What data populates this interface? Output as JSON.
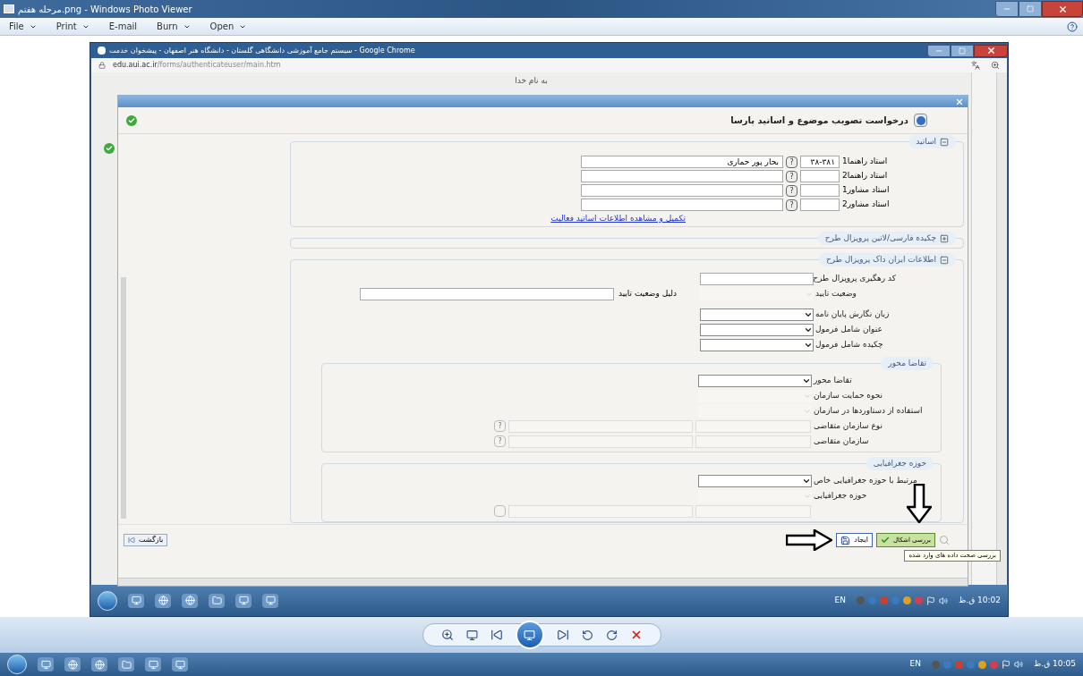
{
  "viewer": {
    "title": "مرحله هفتم.png - Windows Photo Viewer",
    "menu": {
      "file": {
        "label": "File",
        "dropdown": true
      },
      "print": {
        "label": "Print",
        "dropdown": true
      },
      "email": {
        "label": "E-mail",
        "dropdown": false
      },
      "burn": {
        "label": "Burn",
        "dropdown": true
      },
      "open": {
        "label": "Open",
        "dropdown": true
      }
    }
  },
  "browser": {
    "title": "سیستم جامع آموزشی دانشگاهی گلستان - دانشگاه هنر اصفهان - پیشخوان خدمت - Google Chrome",
    "url_host": "edu.aui.ac.ir",
    "url_path": "/forms/authenticateuser/main.htm",
    "page_heading": "به نام خدا"
  },
  "dialog": {
    "title": "درخواست تصویب موضوع و اساتید پارسا",
    "sections": [
      {
        "kind": "lecturers",
        "title": "اساتید",
        "expanded": true,
        "rows": [
          {
            "label": "استاد راهنما1",
            "code": "۳۸-۳۸۱",
            "name": "بحار پور حماری",
            "button": "?"
          },
          {
            "label": "استاد راهنما2",
            "code": "",
            "name": "",
            "button": "?"
          },
          {
            "label": "استاد مشاور1",
            "code": "",
            "name": "",
            "button": "?"
          },
          {
            "label": "استاد مشاور2",
            "code": "",
            "name": "",
            "button": "?"
          }
        ],
        "link": "تکمیل و مشاهده اطلاعات اساتید فعالیت"
      },
      {
        "kind": "plain",
        "title": "چکیده فارسی/لاتین پروپزال طرح",
        "expanded": false
      },
      {
        "kind": "form",
        "title": "اطلاعات ایران داک پروپزال طرح",
        "expanded": true,
        "fields": [
          {
            "kind": "text",
            "label": "کد رهگیری پروپزال طرح",
            "disabled": false
          },
          {
            "kind": "select",
            "label": "وضعیت تایید",
            "disabled": true,
            "extra_label": "دلیل وضعیت تایید"
          },
          {
            "kind": "select",
            "label": "زبان نگارش پایان نامه",
            "disabled": false
          },
          {
            "kind": "select",
            "label": "عنوان شامل فرمول",
            "disabled": false
          },
          {
            "kind": "select",
            "label": "چکیده شامل فرمول",
            "disabled": false
          }
        ],
        "groups": [
          {
            "title": "تقاضا محور",
            "fields": [
              {
                "kind": "select",
                "label": "تقاضا محور",
                "disabled": false
              },
              {
                "kind": "select",
                "label": "نحوه حمایت سازمان",
                "disabled": true
              },
              {
                "kind": "select",
                "label": "استفاده از دستاوردها در سازمان",
                "disabled": true
              },
              {
                "kind": "lookup",
                "label": "نوع سازمان متقاضی",
                "disabled": true,
                "button": "?"
              },
              {
                "kind": "lookup",
                "label": "سازمان متقاضی",
                "disabled": true,
                "button": "?"
              }
            ]
          },
          {
            "title": "حوزه جغرافیایی",
            "fields": [
              {
                "kind": "select",
                "label": "مرتبط با حوزه جغرافیایی خاص",
                "disabled": false
              },
              {
                "kind": "select",
                "label": "حوزه جغرافیایی",
                "disabled": true
              },
              {
                "kind": "lookup",
                "disabled": true
              }
            ]
          }
        ]
      }
    ],
    "footer": {
      "back": "بازگشت",
      "create": "ایجاد",
      "check": "بررسی اشکال",
      "tooltip": "بررسی صحت داده های وارد شده"
    }
  },
  "inner_taskbar": {
    "language": "EN",
    "clock": "10:02 ق.ظ"
  },
  "taskbar": {
    "language": "EN",
    "clock": "10:05 ق.ظ"
  }
}
